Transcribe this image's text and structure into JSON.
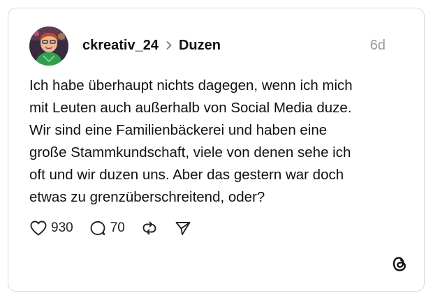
{
  "post": {
    "username": "ckreativ_24",
    "topic": "Duzen",
    "time": "6d",
    "lines": [
      "Ich habe überhaupt nichts dagegen, wenn ich mich",
      "mit Leuten auch außerhalb von Social Media duze.",
      "Wir sind eine Familienbäckerei und haben eine",
      "große Stammkundschaft, viele von denen sehe ich",
      "oft und wir duzen uns. Aber das gestern war doch",
      "etwas zu grenzüberschreitend, oder?"
    ]
  },
  "actions": {
    "likes": "930",
    "replies": "70"
  },
  "icons": {
    "like": "heart-icon",
    "reply": "comment-icon",
    "repost": "repost-icon",
    "share": "send-icon",
    "separator": "chevron-right-icon",
    "brand": "threads-logo"
  },
  "colors": {
    "text": "#111111",
    "muted": "#999999",
    "border": "#d9d9d9"
  }
}
